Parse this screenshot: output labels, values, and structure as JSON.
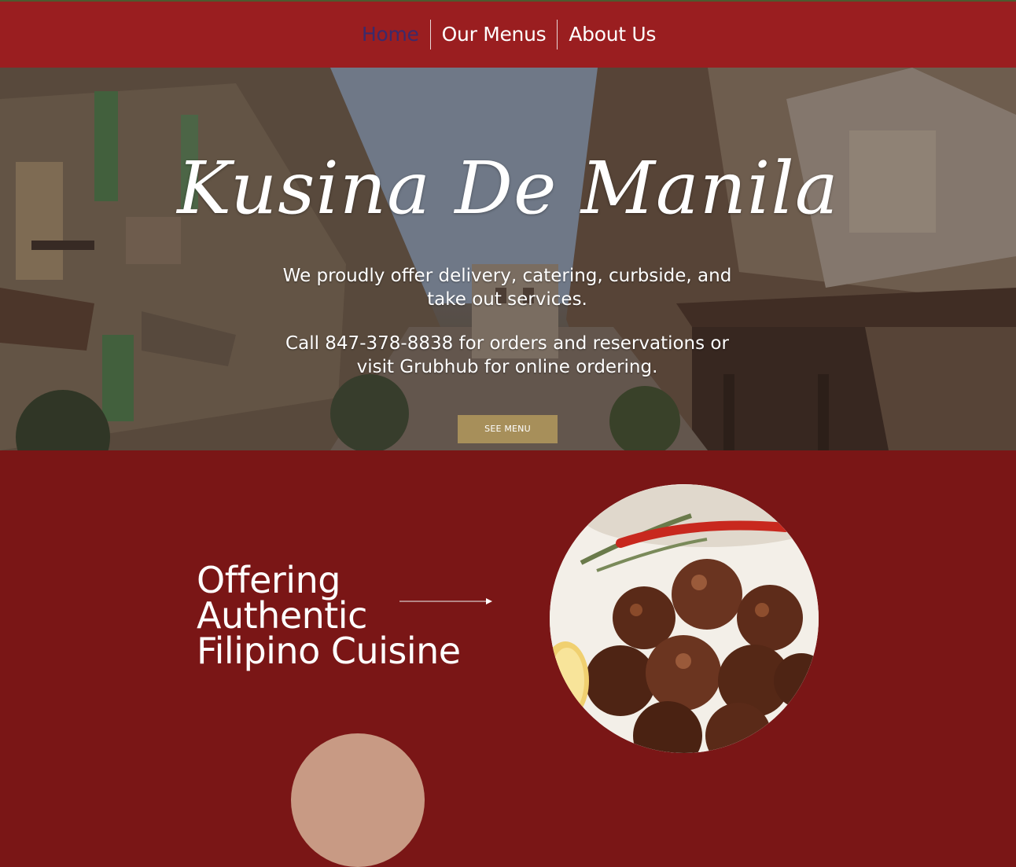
{
  "nav": {
    "items": [
      {
        "label": "Home",
        "active": true
      },
      {
        "label": "Our Menus",
        "active": false
      },
      {
        "label": "About Us",
        "active": false
      }
    ]
  },
  "hero": {
    "title": "Kusina De Manila",
    "services_text": "We proudly offer delivery, catering, curbside, and take out services.",
    "call_text": "Call 847-378-8838 for orders and reservations or visit Grubhub for online ordering.",
    "button_label": "SEE MENU"
  },
  "section": {
    "tagline_lines": [
      "Offering",
      "Authentic",
      "Filipino Cuisine"
    ]
  },
  "colors": {
    "nav_bg": "#9a1e20",
    "section_bg": "#7a1616",
    "button_bg": "#a78f5a",
    "active_nav": "#3b2a6b"
  },
  "icons": {
    "arrow": "right-arrow-icon"
  }
}
